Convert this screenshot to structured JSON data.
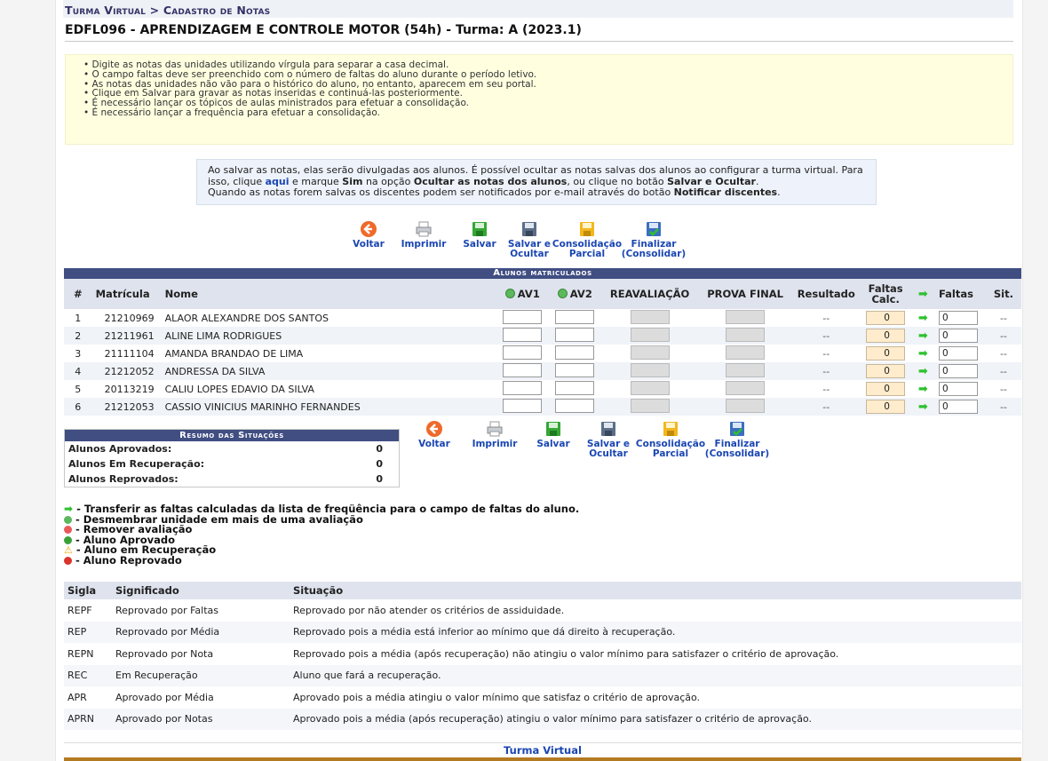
{
  "breadcrumb": "Turma Virtual > Cadastro de Notas",
  "page_title": "EDFL096 - APRENDIZAGEM E CONTROLE MOTOR (54h) - Turma: A (2023.1)",
  "instructions": [
    "Digite as notas das unidades utilizando vírgula para separar a casa decimal.",
    "O campo faltas deve ser preenchido com o número de faltas do aluno durante o período letivo.",
    "As notas das unidades não vão para o histórico do aluno, no entanto, aparecem em seu portal.",
    "Clique em Salvar para gravar as notas inseridas e continuá-las posteriormente.",
    "É necessário lançar os tópicos de aulas ministrados para efetuar a consolidação.",
    "É necessário lançar a frequência para efetuar a consolidação."
  ],
  "notice": {
    "p1": "Ao salvar as notas, elas serão divulgadas aos alunos. É possível ocultar as notas salvas dos alunos ao configurar a turma virtual. Para isso, clique ",
    "link": "aqui",
    "p2": " e marque ",
    "b1": "Sim",
    "p3": " na opção ",
    "b2": "Ocultar as notas dos alunos",
    "p4": ", ou clique no botão ",
    "b3": "Salvar e Ocultar",
    "p5": ".",
    "p6": "Quando as notas forem salvas os discentes podem ser notificados por e-mail através do botão ",
    "b4": "Notificar discentes",
    "p7": "."
  },
  "toolbar": {
    "voltar": "Voltar",
    "imprimir": "Imprimir",
    "salvar": "Salvar",
    "salvar_ocultar_1": "Salvar e",
    "salvar_ocultar_2": "Ocultar",
    "consolidacao_1": "Consolidação",
    "consolidacao_2": "Parcial",
    "finalizar_1": "Finalizar",
    "finalizar_2": "(Consolidar)"
  },
  "grid": {
    "title": "Alunos matriculados",
    "headers": {
      "num": "#",
      "matricula": "Matrícula",
      "nome": "Nome",
      "av1": "AV1",
      "av2": "AV2",
      "reavaliacao": "REAVALIAÇÃO",
      "prova_final": "PROVA FINAL",
      "resultado": "Resultado",
      "faltas_calc_1": "Faltas",
      "faltas_calc_2": "Calc.",
      "faltas": "Faltas",
      "sit": "Sit."
    },
    "rows": [
      {
        "n": "1",
        "matricula": "21210969",
        "nome": "ALAOR ALEXANDRE DOS SANTOS",
        "resultado": "--",
        "faltas_calc": "0",
        "faltas": "0",
        "sit": "--"
      },
      {
        "n": "2",
        "matricula": "21211961",
        "nome": "ALINE LIMA RODRIGUES",
        "resultado": "--",
        "faltas_calc": "0",
        "faltas": "0",
        "sit": "--"
      },
      {
        "n": "3",
        "matricula": "21111104",
        "nome": "AMANDA BRANDAO DE LIMA",
        "resultado": "--",
        "faltas_calc": "0",
        "faltas": "0",
        "sit": "--"
      },
      {
        "n": "4",
        "matricula": "21212052",
        "nome": "ANDRESSA DA SILVA",
        "resultado": "--",
        "faltas_calc": "0",
        "faltas": "0",
        "sit": "--"
      },
      {
        "n": "5",
        "matricula": "20113219",
        "nome": "CALIU LOPES EDAVIO DA SILVA",
        "resultado": "--",
        "faltas_calc": "0",
        "faltas": "0",
        "sit": "--"
      },
      {
        "n": "6",
        "matricula": "21212053",
        "nome": "CASSIO VINICIUS MARINHO FERNANDES",
        "resultado": "--",
        "faltas_calc": "0",
        "faltas": "0",
        "sit": "--"
      }
    ]
  },
  "summary": {
    "title": "Resumo das Situações",
    "aprovados_label": "Alunos Aprovados:",
    "aprovados": "0",
    "recuperacao_label": "Alunos Em Recuperação:",
    "recuperacao": "0",
    "reprovados_label": "Alunos Reprovados:",
    "reprovados": "0"
  },
  "legend": {
    "transferir": "- Transferir as faltas calculadas da lista de freqüência para o campo de faltas do aluno.",
    "desmembrar": "- Desmembrar unidade em mais de uma avaliação",
    "remover": "- Remover avaliação",
    "aprovado": "- Aluno Aprovado",
    "recuperacao": "- Aluno em Recuperação",
    "reprovado": "- Aluno Reprovado"
  },
  "siglas": {
    "headers": {
      "sigla": "Sigla",
      "significado": "Significado",
      "situacao": "Situação"
    },
    "rows": [
      {
        "sigla": "REPF",
        "significado": "Reprovado por Faltas",
        "situacao": "Reprovado por não atender os critérios de assiduidade."
      },
      {
        "sigla": "REP",
        "significado": "Reprovado por Média",
        "situacao": "Reprovado pois a média está inferior ao mínimo que dá direito à recuperação."
      },
      {
        "sigla": "REPN",
        "significado": "Reprovado por Nota",
        "situacao": "Reprovado pois a média (após recuperação) não atingiu o valor mínimo para satisfazer o critério de aprovação."
      },
      {
        "sigla": "REC",
        "significado": "Em Recuperação",
        "situacao": "Aluno que fará a recuperação."
      },
      {
        "sigla": "APR",
        "significado": "Aprovado por Média",
        "situacao": "Aprovado pois a média atingiu o valor mínimo que satisfaz o critério de aprovação."
      },
      {
        "sigla": "APRN",
        "significado": "Aprovado por Notas",
        "situacao": "Aprovado pois a média (após recuperação) atingiu o valor mínimo para satisfazer o critério de aprovação."
      }
    ]
  },
  "footer": "Turma Virtual",
  "colors": {
    "header_blue": "#404e82",
    "link_blue": "#1a46b2",
    "info_bg": "#ffffe0",
    "arrow_green": "#2ec12e"
  },
  "icons": {
    "voltar": "back-arrow-icon",
    "imprimir": "printer-icon",
    "salvar": "floppy-save-icon",
    "salvar_ocultar": "floppy-hide-icon",
    "consolidacao": "floppy-partial-icon",
    "finalizar": "floppy-finalize-icon"
  }
}
